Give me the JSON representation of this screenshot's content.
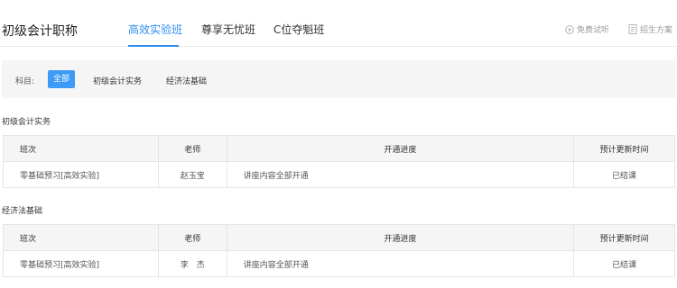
{
  "header": {
    "title": "初级会计职称",
    "tabs": [
      {
        "label": "高效实验班",
        "active": true
      },
      {
        "label": "尊享无忧班",
        "active": false
      },
      {
        "label": "C位夺魁班",
        "active": false
      }
    ],
    "links": [
      {
        "label": "免费试听",
        "icon": "play-circle-icon"
      },
      {
        "label": "招生方案",
        "icon": "document-icon"
      }
    ],
    "accent_color": "#2f8cf0"
  },
  "filter": {
    "label": "科目:",
    "options": [
      {
        "label": "全部",
        "active": true
      },
      {
        "label": "初级会计实务",
        "active": false
      },
      {
        "label": "经济法基础",
        "active": false
      }
    ]
  },
  "columns": [
    "班次",
    "老师",
    "开通进度",
    "预计更新时间"
  ],
  "sections": [
    {
      "title": "初级会计实务",
      "rows": [
        {
          "class_name": "零基础预习[高效实验]",
          "teacher": "赵玉宝",
          "progress": "讲座内容全部开通",
          "update_time": "已结课"
        }
      ]
    },
    {
      "title": "经济法基础",
      "rows": [
        {
          "class_name": "零基础预习[高效实验]",
          "teacher": "李　杰",
          "progress": "讲座内容全部开通",
          "update_time": "已结课"
        }
      ]
    }
  ]
}
